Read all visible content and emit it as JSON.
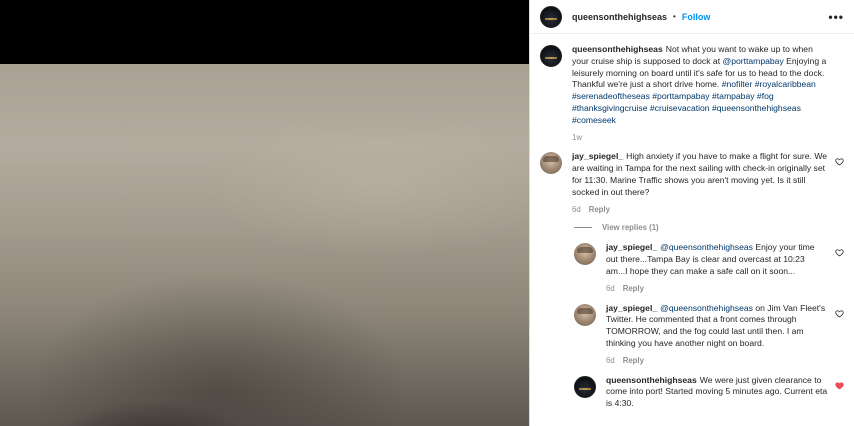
{
  "post": {
    "username": "queensonthehighseas",
    "follow_label": "Follow",
    "separator": "•",
    "more_label": "•••",
    "caption": {
      "username": "queensonthehighseas",
      "segments": [
        {
          "t": "Not what you want to wake up to when your cruise ship is supposed to dock at ",
          "type": "text"
        },
        {
          "t": "@porttampabay",
          "type": "mention"
        },
        {
          "t": " Enjoying a leisurely morning on board until it's safe for us to head to the dock. Thankful we're just a short drive home. ",
          "type": "text"
        },
        {
          "t": "#nofilter",
          "type": "tag"
        },
        {
          "t": " ",
          "type": "text"
        },
        {
          "t": "#royalcaribbean",
          "type": "tag"
        },
        {
          "t": " ",
          "type": "text"
        },
        {
          "t": "#serenadeoftheseas",
          "type": "tag"
        },
        {
          "t": " ",
          "type": "text"
        },
        {
          "t": "#porttampabay",
          "type": "tag"
        },
        {
          "t": " ",
          "type": "text"
        },
        {
          "t": "#tampabay",
          "type": "tag"
        },
        {
          "t": " ",
          "type": "text"
        },
        {
          "t": "#fog",
          "type": "tag"
        },
        {
          "t": " ",
          "type": "text"
        },
        {
          "t": "#thanksgivingcruise",
          "type": "tag"
        },
        {
          "t": " ",
          "type": "text"
        },
        {
          "t": "#cruisevacation",
          "type": "tag"
        },
        {
          "t": " ",
          "type": "text"
        },
        {
          "t": "#queensonthehighseas",
          "type": "tag"
        },
        {
          "t": " ",
          "type": "text"
        },
        {
          "t": "#comeseek",
          "type": "tag"
        }
      ],
      "time": "1w"
    }
  },
  "comments": [
    {
      "username": "jay_spiegel_",
      "segments": [
        {
          "t": "High anxiety if you have to make a flight for sure. We are waiting in Tampa for the next sailing with check-in originally set for 11:30. Marine Traffic shows you aren't moving yet. Is it still socked in out there?",
          "type": "text"
        }
      ],
      "time": "6d",
      "reply_label": "Reply",
      "liked": false
    }
  ],
  "view_replies_label": "View replies (1)",
  "replies": [
    {
      "username": "jay_spiegel_",
      "avatar": "person",
      "segments": [
        {
          "t": "@queensonthehighseas",
          "type": "mention"
        },
        {
          "t": " Enjoy your time out there...Tampa Bay is clear and overcast at 10:23 am...I hope they can make a safe call on it soon...",
          "type": "text"
        }
      ],
      "time": "6d",
      "reply_label": "Reply",
      "liked": false
    },
    {
      "username": "jay_spiegel_",
      "avatar": "person",
      "segments": [
        {
          "t": "@queensonthehighseas",
          "type": "mention"
        },
        {
          "t": " on Jim Van Fleet's Twitter. He commented that a front comes through TOMORROW, and the fog could last until then. I am thinking you have another night on board.",
          "type": "text"
        }
      ],
      "time": "6d",
      "reply_label": "Reply",
      "liked": false
    },
    {
      "username": "queensonthehighseas",
      "avatar": "ship",
      "segments": [
        {
          "t": "We were just given clearance to come into port! Started moving 5 minutes ago. Current eta is 4:30.",
          "type": "text"
        }
      ],
      "time": "",
      "reply_label": "",
      "liked": true
    }
  ],
  "colors": {
    "link": "#0095f6",
    "hashtag": "#00376b",
    "muted": "#8e8e8e",
    "liked": "#ed4956"
  },
  "icons": {
    "heart": "heart-icon",
    "heart_filled": "heart-filled-icon",
    "more": "more-options-icon"
  }
}
